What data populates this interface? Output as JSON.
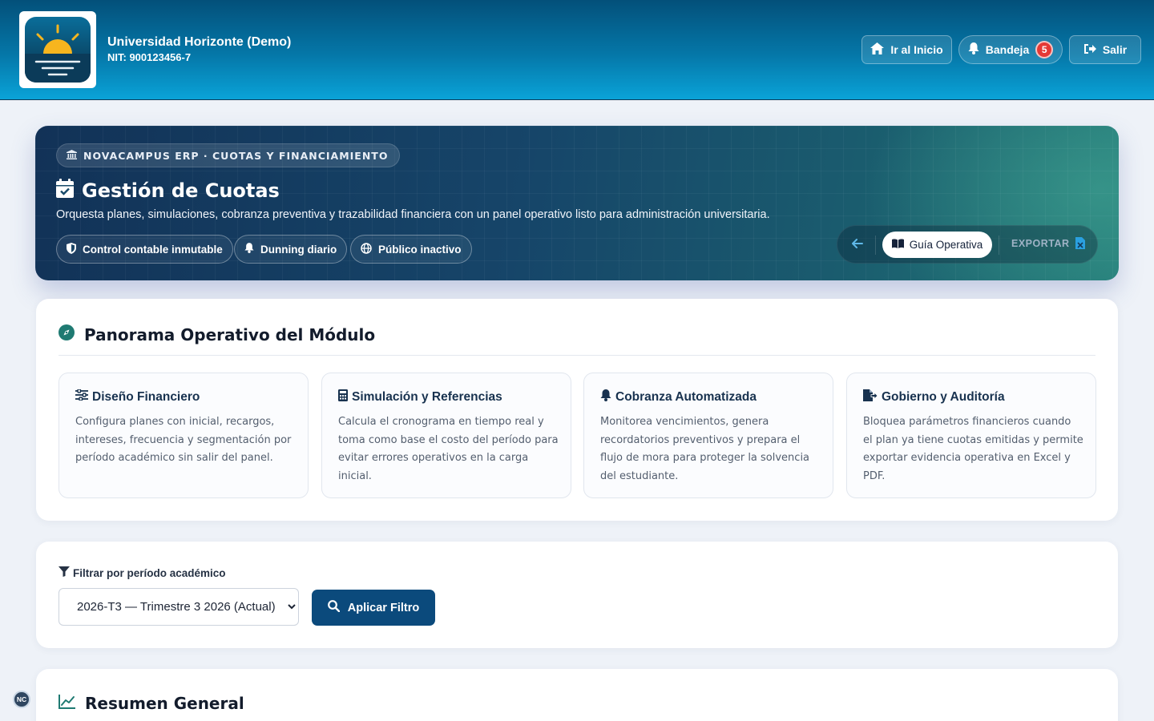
{
  "header": {
    "institution": "Universidad Horizonte (Demo)",
    "nit": "NIT: 900123456-7",
    "home_label": "Ir al Inicio",
    "inbox_label": "Bandeja",
    "inbox_count": "5",
    "exit_label": "Salir"
  },
  "hero": {
    "tag": "NOVACAMPUS ERP · CUOTAS Y FINANCIAMIENTO",
    "title": "Gestión de Cuotas",
    "description": "Orquesta planes, simulaciones, cobranza preventiva y trazabilidad financiera con un panel operativo listo para administración universitaria.",
    "chips": [
      "Control contable inmutable",
      "Dunning diario",
      "Público inactivo"
    ],
    "guide_label": "Guía Operativa",
    "export_label": "EXPORTAR"
  },
  "panorama": {
    "title": "Panorama Operativo del Módulo",
    "features": [
      {
        "title": "Diseño Financiero",
        "text": "Configura planes con inicial, recargos, intereses, frecuencia y segmentación por período académico sin salir del panel."
      },
      {
        "title": "Simulación y Referencias",
        "text": "Calcula el cronograma en tiempo real y toma como base el costo del período para evitar errores operativos en la carga inicial."
      },
      {
        "title": "Cobranza Automatizada",
        "text": "Monitorea vencimientos, genera recordatorios preventivos y prepara el flujo de mora para proteger la solvencia del estudiante."
      },
      {
        "title": "Gobierno y Auditoría",
        "text": "Bloquea parámetros financieros cuando el plan ya tiene cuotas emitidas y permite exportar evidencia operativa en Excel y PDF."
      }
    ]
  },
  "filter": {
    "label": "Filtrar por período académico",
    "selected_period": "2026-T3 — Trimestre 3 2026 (Actual)",
    "apply_label": "Aplicar Filtro"
  },
  "summary": {
    "title": "Resumen General"
  },
  "footer": {
    "nc_badge": "NC"
  },
  "colors": {
    "primary": "#0b4a7c",
    "accent_teal": "#1f8a7a",
    "badge_red": "#e53935"
  }
}
